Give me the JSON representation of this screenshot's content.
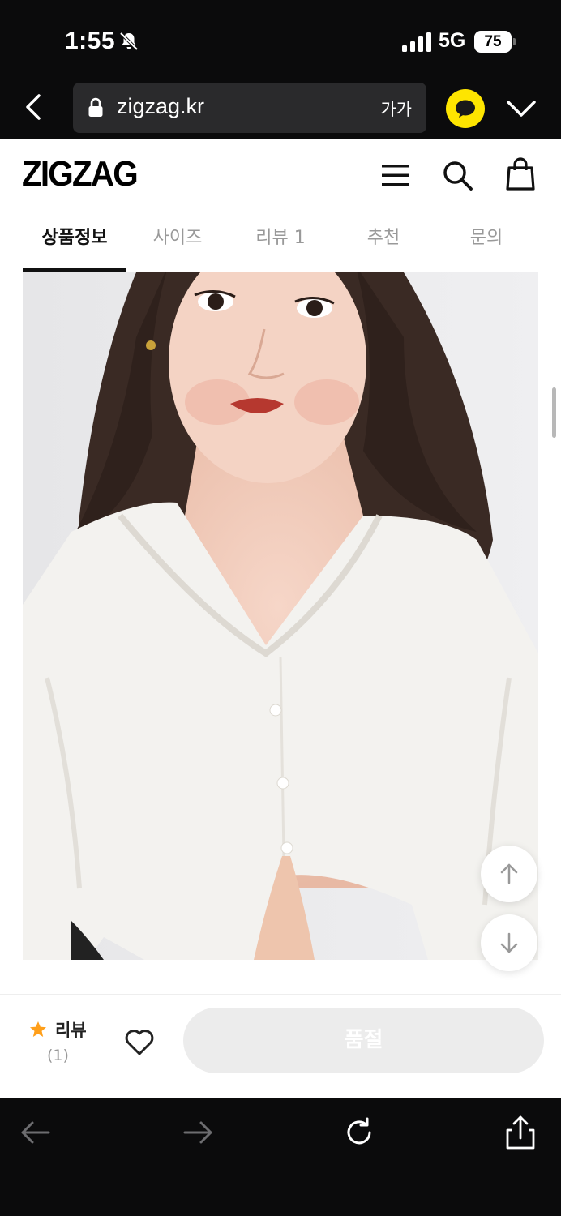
{
  "status_bar": {
    "time": "1:55",
    "network": "5G",
    "battery": "75"
  },
  "browser": {
    "url": "zigzag.kr",
    "text_size": "가가"
  },
  "header": {
    "logo": "ZIGZAG"
  },
  "tabs": [
    {
      "label": "상품정보",
      "active": true
    },
    {
      "label": "사이즈",
      "active": false
    },
    {
      "label": "리뷰 1",
      "active": false
    },
    {
      "label": "추천",
      "active": false
    },
    {
      "label": "문의",
      "active": false
    }
  ],
  "purchase_bar": {
    "review_label": "리뷰",
    "review_count": "(1)",
    "buy_button": "품절"
  },
  "colors": {
    "background": "#0b0b0c",
    "kakao": "#fee500",
    "star": "#ff9f1a",
    "soldout": "#ececec"
  },
  "icons": [
    "bell-slash-icon",
    "signal-icon",
    "lock-icon",
    "chevron-left-icon",
    "kakao-chat-icon",
    "chevron-down-icon",
    "menu-icon",
    "search-icon",
    "shopping-bag-icon",
    "arrow-up-icon",
    "arrow-down-icon",
    "star-icon",
    "heart-icon",
    "arrow-left-icon",
    "arrow-right-icon",
    "reload-icon",
    "share-icon"
  ]
}
